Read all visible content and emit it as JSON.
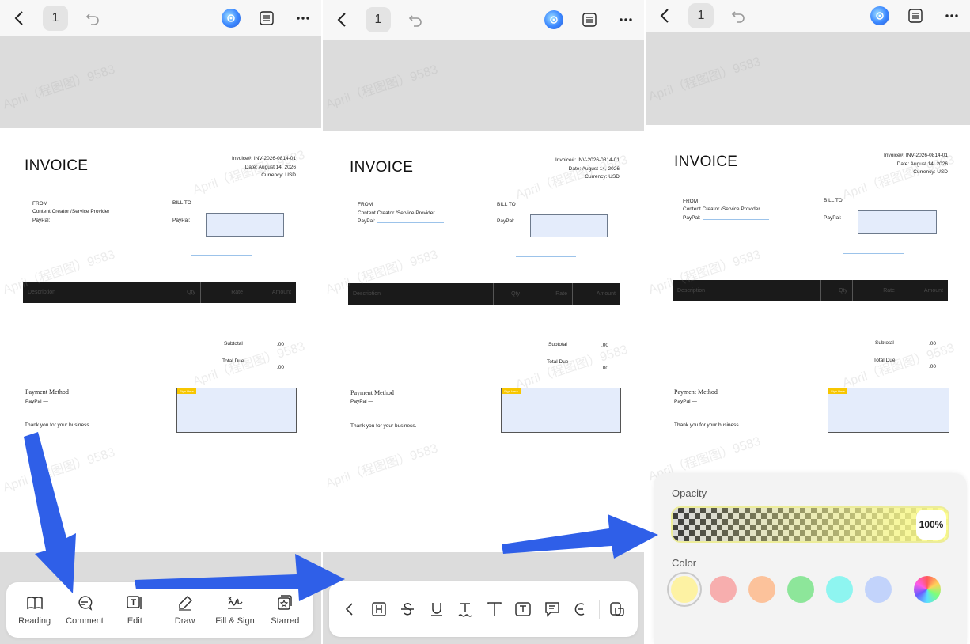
{
  "topbar": {
    "page_number": "1"
  },
  "invoice": {
    "title": "INVOICE",
    "meta": [
      "Invoice#: INV-2026-0814-01",
      "Date: August 14, 2026",
      "Currency: USD"
    ],
    "from_label": "FROM",
    "from_name": "Content Creator /Service Provider",
    "paypal_label": "PayPal:",
    "bill_to_label": "BILL TO",
    "bill_paypal_label": "PayPal:",
    "columns": [
      "Description",
      "Qty",
      "Rate",
      "Amount"
    ],
    "subtotal_label": "Subtotal",
    "subtotal_value": ".00",
    "total_due_label": "Total Due",
    "total_due_value": ".00",
    "payment_method_label": "Payment Method",
    "payment_paypal": "PayPal —",
    "thanks": "Thank you for your business.",
    "sign_tag": "Sign Here"
  },
  "watermark": "April（程图图）9583",
  "toolbar": {
    "items": [
      {
        "label": "Reading",
        "icon": "book-icon"
      },
      {
        "label": "Comment",
        "icon": "comment-icon"
      },
      {
        "label": "Edit",
        "icon": "edit-text-icon"
      },
      {
        "label": "Draw",
        "icon": "pen-icon"
      },
      {
        "label": "Fill & Sign",
        "icon": "signature-icon"
      },
      {
        "label": "Starred",
        "icon": "star-box-icon"
      }
    ]
  },
  "comment_toolbar": {
    "icons": [
      "back-chevron-icon",
      "highlight-icon",
      "strikethrough-icon",
      "underline-icon",
      "squiggly-text-icon",
      "text-icon",
      "text-box-icon",
      "note-icon",
      "eraser-icon",
      "tap-hand-icon"
    ]
  },
  "color_sheet": {
    "opacity_label": "Opacity",
    "opacity_value": "100%",
    "opacity_fraction": 1.0,
    "color_label": "Color",
    "swatches": [
      "#fdf2a3",
      "#f7aeae",
      "#fcc29b",
      "#8de69a",
      "#8ef5f0",
      "#c2d3fb"
    ],
    "selected_swatch": 0
  },
  "colors": {
    "arrow": "#2f5fe8",
    "accent_blue": "#3a86ff"
  }
}
